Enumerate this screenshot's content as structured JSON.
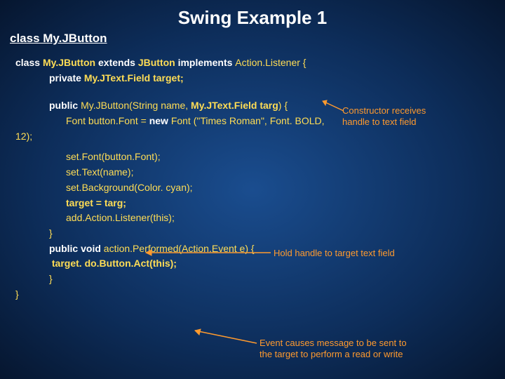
{
  "title": "Swing Example 1",
  "subtitle": "class My.JButton",
  "code": {
    "l1_a": "class ",
    "l1_b": "My.JButton ",
    "l1_c": "extends ",
    "l1_d": "JButton ",
    "l1_e": "implements ",
    "l1_f": "Action.Listener {",
    "l2_a": "private ",
    "l2_b": "My.JText.Field target;",
    "l3_a": "public ",
    "l3_b": "My.JButton(String name, ",
    "l3_c": "My.JText.Field targ",
    "l3_d": ") {",
    "l4_a": "Font button.Font = ",
    "l4_b": "new ",
    "l4_c": "Font (\"Times Roman\", Font. BOLD,",
    "l5": "12);",
    "l6": "set.Font(button.Font);",
    "l7": "set.Text(name);",
    "l8": "set.Background(Color. cyan);",
    "l9": "target = targ;",
    "l10": "add.Action.Listener(this);",
    "l11": "}",
    "l12_a": "public void ",
    "l12_b": "action.Performed(Action.Event e) {",
    "l13": " target. do.Button.Act(this);",
    "l14": "}",
    "l15": "}"
  },
  "notes": {
    "n1": "Constructor receives\nhandle to text field",
    "n2": "Hold handle to target text field",
    "n3": "Event causes message to be sent to\nthe target to perform a read or write"
  }
}
